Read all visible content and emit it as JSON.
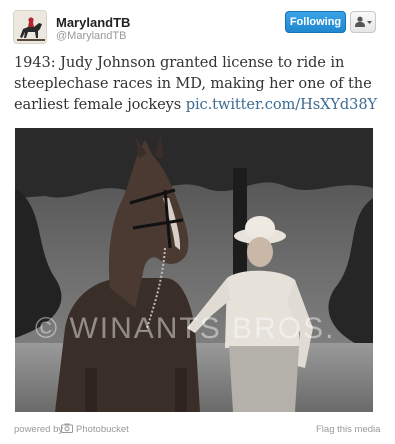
{
  "account": {
    "display_name": "MarylandTB",
    "screen_name": "@MarylandTB",
    "avatar_icon": "horse-rider-avatar-icon"
  },
  "header": {
    "follow_label": "Following",
    "user_menu_icon": "person-dropdown-icon"
  },
  "tweet": {
    "text": "1943: Judy Johnson granted license to ride in steeplechase races in MD, making her one of the earliest female jockeys ",
    "link": "pic.twitter.com/HsXYd38Y"
  },
  "photo": {
    "watermark": "© WINANTS BROS."
  },
  "footer": {
    "powered_by": "powered by",
    "provider_icon": "camera-icon",
    "provider": "Photobucket",
    "flag_label": "Flag this media"
  },
  "colors": {
    "follow_button": "#2b93dd",
    "link": "#3b6b92",
    "muted_text": "#999999"
  }
}
